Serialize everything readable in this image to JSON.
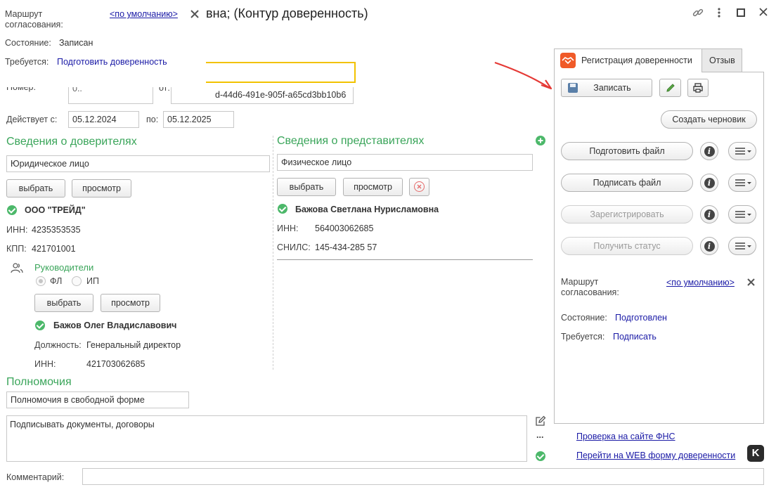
{
  "window": {
    "title": "вна; (Контур доверенность)",
    "icons": [
      "link-icon",
      "more-icon",
      "maximize-icon",
      "close-icon"
    ]
  },
  "popup": {
    "route_label": "Маршрут согласования:",
    "route_value": "<по умолчанию>",
    "state_label": "Состояние:",
    "state_value": "Записан",
    "required_label": "Требуется:",
    "required_value": "Подготовить доверенность"
  },
  "header": {
    "number_label": "Номер:",
    "number_value": "0..",
    "guid_value": "d-44d6-491e-905f-a65cd3bb10b6",
    "valid_from_label": "Действует с:",
    "valid_from": "05.12.2024",
    "valid_to_label": "по:",
    "valid_to": "05.12.2025"
  },
  "principals": {
    "title": "Сведения о доверителях",
    "type": "Юридическое лицо",
    "select_label": "выбрать",
    "view_label": "просмотр",
    "org_name": "ООО \"ТРЕЙД\"",
    "inn_label": "ИНН:",
    "inn": "4235353535",
    "kpp_label": "КПП:",
    "kpp": "421701001",
    "heads": {
      "title": "Руководители",
      "radio_fl": "ФЛ",
      "radio_ip": "ИП",
      "select_label": "выбрать",
      "view_label": "просмотр",
      "person": "Бажов Олег Владиславович",
      "position_label": "Должность:",
      "position": "Генеральный директор",
      "inn_label": "ИНН:",
      "inn": "421703062685"
    }
  },
  "representatives": {
    "title": "Сведения о представителях",
    "type": "Физическое лицо",
    "select_label": "выбрать",
    "view_label": "просмотр",
    "person": "Бажова Светлана Нурисламовна",
    "inn_label": "ИНН:",
    "inn": "564003062685",
    "snils_label": "СНИЛС:",
    "snils": "145-434-285 57"
  },
  "powers": {
    "title": "Полномочия",
    "type": "Полномочия в свободной форме",
    "text": "Подписывать документы, договоры",
    "dots": "..."
  },
  "comment": {
    "label": "Комментарий:",
    "value": ""
  },
  "side_panel": {
    "tabs": [
      "Регистрация доверенности",
      "Отзыв"
    ],
    "save_label": "Записать",
    "create_draft": "Создать черновик",
    "actions": [
      {
        "label": "Подготовить файл",
        "enabled": true
      },
      {
        "label": "Подписать файл",
        "enabled": true
      },
      {
        "label": "Зарегистрировать",
        "enabled": false
      },
      {
        "label": "Получить статус",
        "enabled": false
      }
    ],
    "route_label": "Маршрут согласования:",
    "route_value": "<по умолчанию>",
    "state_label": "Состояние:",
    "state_value": "Подготовлен",
    "required_label": "Требуется:",
    "required_value": "Подписать"
  },
  "links": {
    "check_fns": "Проверка на сайте ФНС",
    "web_form": "Перейти на WEB форму доверенности",
    "brand_letter": "K"
  },
  "colors": {
    "accent_green": "#3aa55a",
    "link_blue": "#1a1aa6",
    "highlight_yellow": "#f2c200",
    "arrow_red": "#e53935",
    "tab_icon_bg": "#f05a28"
  }
}
